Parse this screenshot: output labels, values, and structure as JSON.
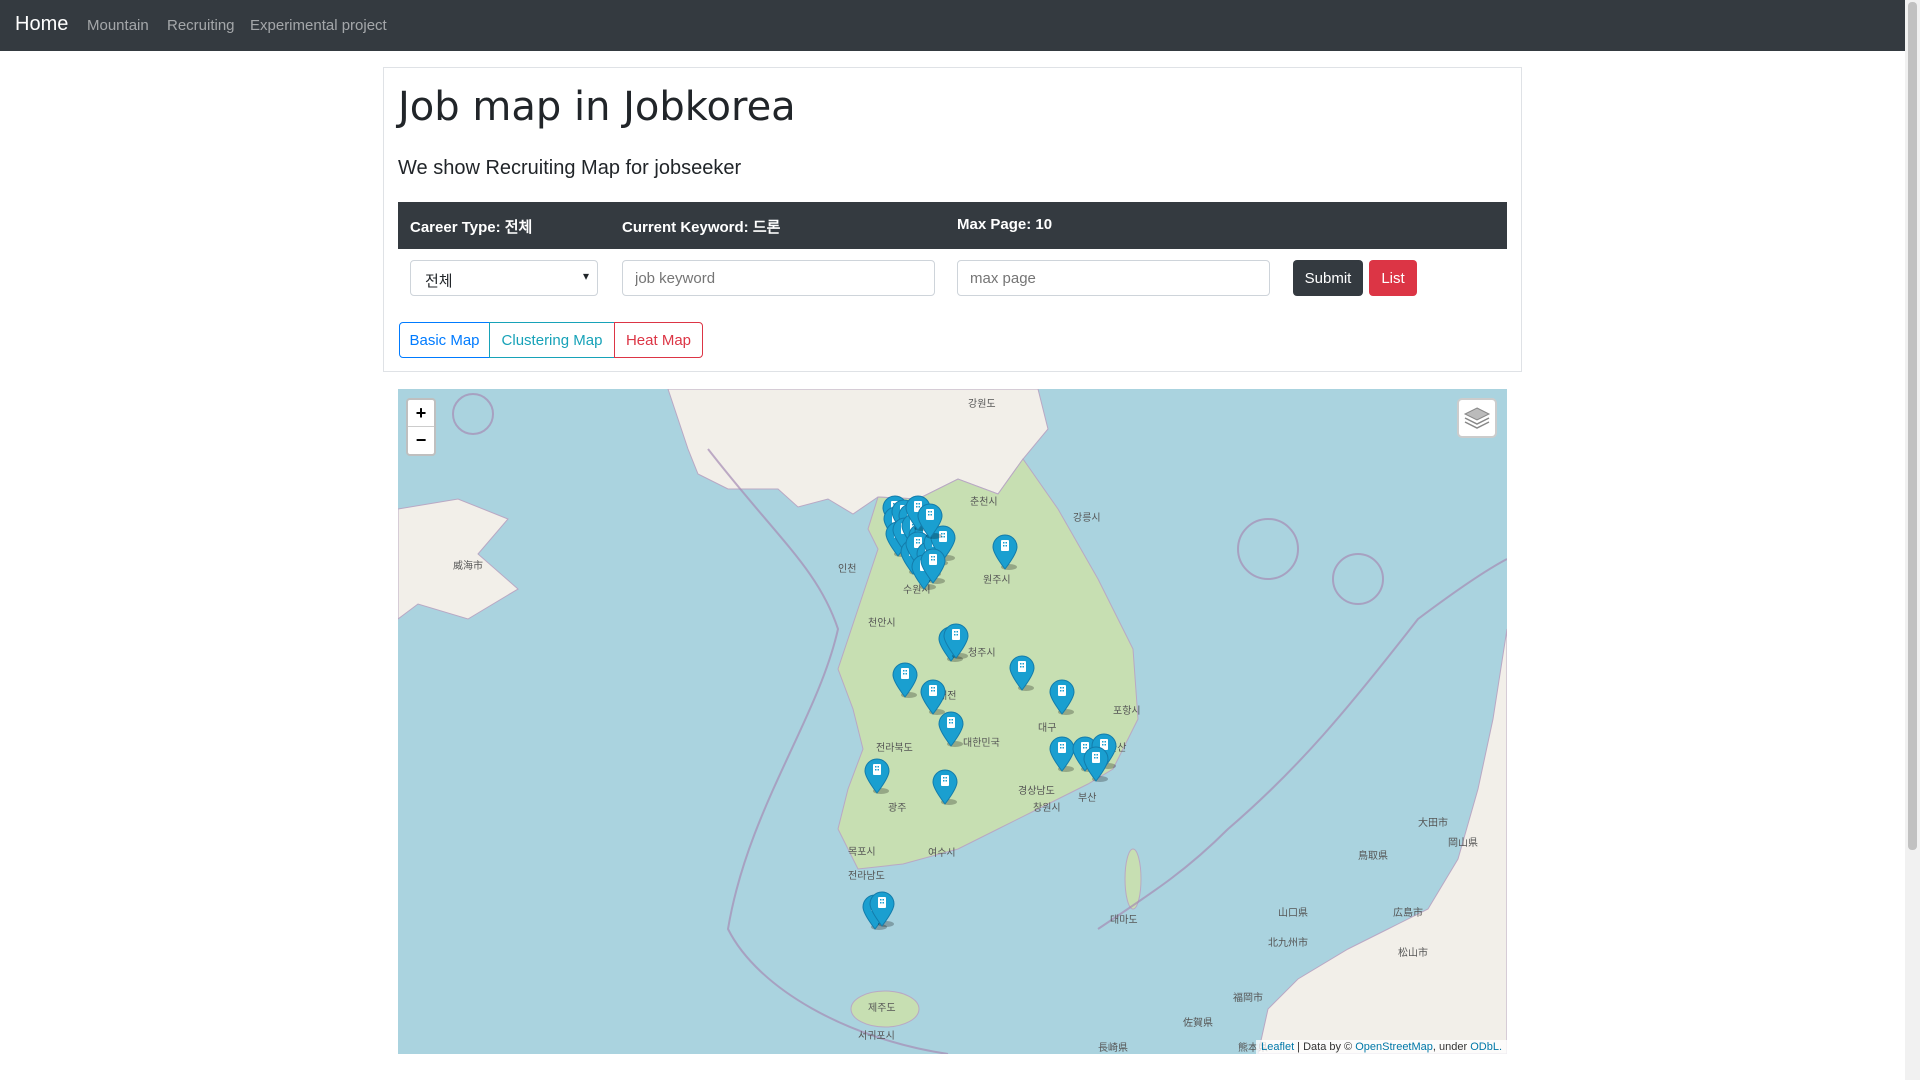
{
  "nav": {
    "brand": "Home",
    "links": [
      "Mountain",
      "Recruiting",
      "Experimental project"
    ]
  },
  "page": {
    "title": "Job map in Jobkorea",
    "subtitle": "We show Recruiting Map for jobseeker"
  },
  "info": {
    "career_type": "Career Type: 전체",
    "current_keyword": "Current Keyword: 드론",
    "max_page": "Max Page: 10"
  },
  "form": {
    "career_select_value": "전체",
    "keyword_placeholder": "job keyword",
    "maxpage_placeholder": "max page",
    "submit_label": "Submit",
    "list_label": "List"
  },
  "map_buttons": [
    "Basic Map",
    "Clustering Map",
    "Heat Map"
  ],
  "map": {
    "zoom_in": "+",
    "zoom_out": "−",
    "attribution": {
      "leaflet": "Leaflet",
      "data_by": " | Data by © ",
      "osm": "OpenStreetMap",
      "under": ", under ",
      "odbl": "ODbL."
    },
    "place_labels": [
      "강원도",
      "춘천시",
      "강릉시",
      "원주시",
      "수원시",
      "인천",
      "천안시",
      "대전",
      "청주시",
      "대구",
      "포항시",
      "경상남도",
      "창원시",
      "광주",
      "목포시",
      "여수시",
      "제주도",
      "서귀포시",
      "대한민국",
      "전라북도",
      "전라남도",
      "울산",
      "부산",
      "대마도",
      "福岡市",
      "広島市",
      "松山市",
      "山口県",
      "北九州市",
      "長崎県",
      "佐賀県",
      "熊本県",
      "鳥取県",
      "岡山県",
      "大田市",
      "威海市"
    ],
    "marker_color": "#1a9fd0"
  },
  "colors": {
    "navbar": "#343a40",
    "primary": "#007bff",
    "info": "#17a2b8",
    "danger": "#dc3545",
    "dark": "#343a40"
  }
}
